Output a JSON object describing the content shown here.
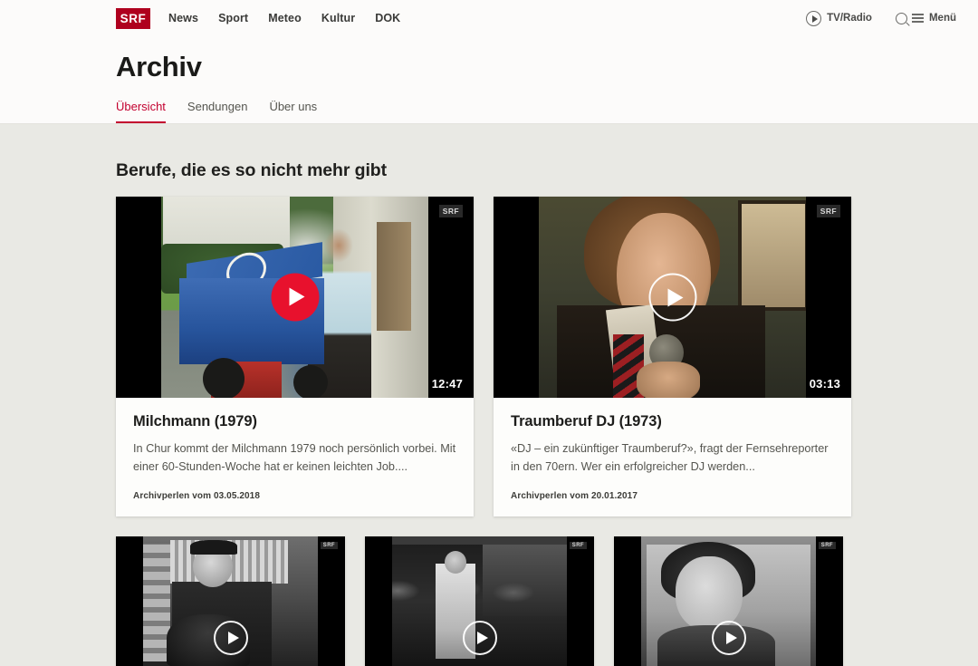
{
  "header": {
    "logo_text": "SRF",
    "brand_color": "#af001e",
    "accent_color": "#c3002f",
    "nav_items": [
      {
        "label": "News"
      },
      {
        "label": "Sport"
      },
      {
        "label": "Meteo"
      },
      {
        "label": "Kultur"
      },
      {
        "label": "DOK"
      }
    ],
    "tv_radio": {
      "label": "TV/Radio",
      "icon": "circle-play-icon"
    },
    "menu": {
      "label": "Menü",
      "icons": [
        "search-icon",
        "hamburger-icon"
      ]
    }
  },
  "page": {
    "title": "Archiv",
    "tabs": [
      {
        "label": "Übersicht",
        "active": true
      },
      {
        "label": "Sendungen",
        "active": false
      },
      {
        "label": "Über uns",
        "active": false
      }
    ]
  },
  "section": {
    "title": "Berufe, die es so nicht mehr gibt",
    "cards": [
      {
        "title": "Milchmann (1979)",
        "description": "In Chur kommt der Milchmann 1979 noch persönlich vorbei. Mit einer 60-Stunden-Woche hat er keinen leichten Job....",
        "meta": "Archivperlen vom 03.05.2018",
        "duration": "12:47",
        "watermark": "SRF",
        "play_state": "hover",
        "play_icon": "play-icon"
      },
      {
        "title": "Traumberuf DJ (1973)",
        "description": "«DJ – ein zukünftiger Traumberuf?», fragt der Fernsehreporter in den 70ern. Wer ein erfolgreicher DJ werden...",
        "meta": "Archivperlen vom 20.01.2017",
        "duration": "03:13",
        "watermark": "SRF",
        "play_state": "default",
        "play_icon": "play-icon"
      }
    ],
    "second_row": [
      {
        "watermark": "SRF",
        "play_icon": "play-icon"
      },
      {
        "watermark": "SRF",
        "play_icon": "play-icon"
      },
      {
        "watermark": "SRF",
        "play_icon": "play-icon"
      }
    ]
  }
}
